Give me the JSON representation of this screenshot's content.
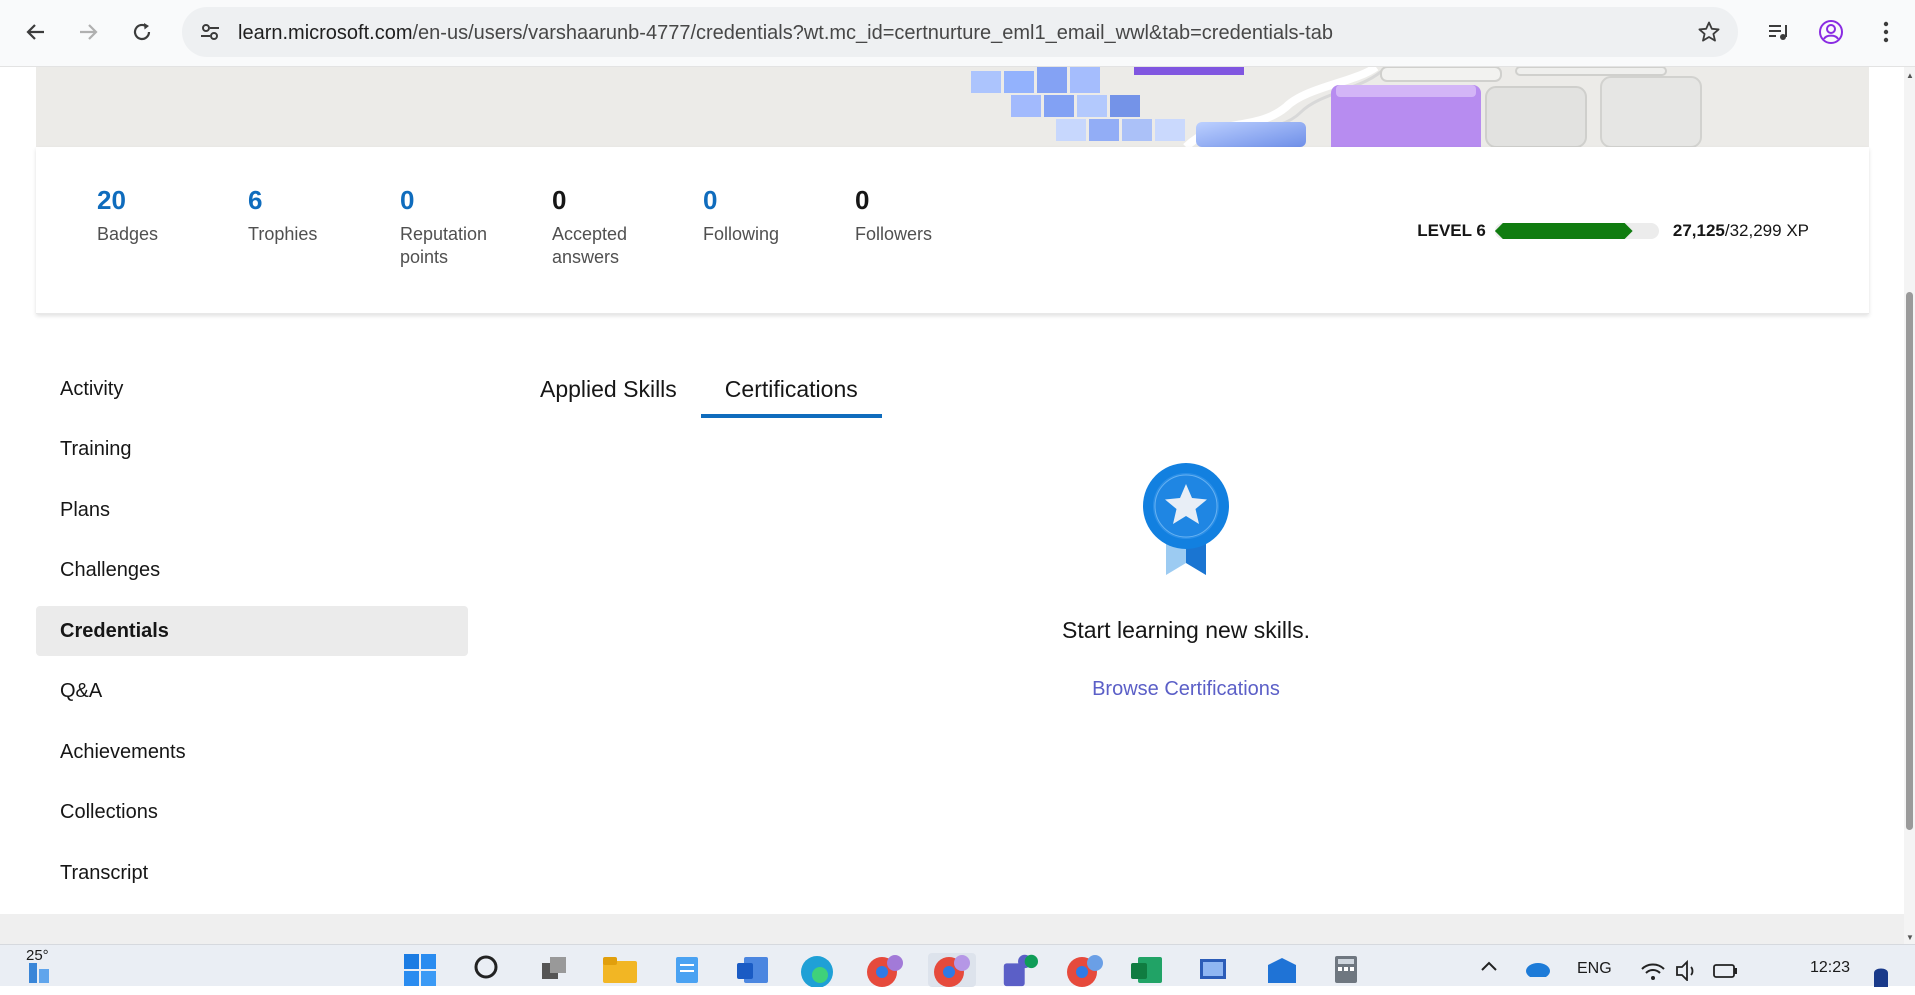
{
  "browser": {
    "url_host": "learn.microsoft.com",
    "url_path": "/en-us/users/varshaarunb-4777/credentials?wt.mc_id=certnurture_eml1_email_wwl&tab=credentials-tab"
  },
  "stats": [
    {
      "value": "20",
      "label": "Badges"
    },
    {
      "value": "6",
      "label": "Trophies"
    },
    {
      "value": "0",
      "label": "Reputation points"
    },
    {
      "value": "0",
      "label": "Accepted answers"
    },
    {
      "value": "0",
      "label": "Following"
    },
    {
      "value": "0",
      "label": "Followers"
    }
  ],
  "level": {
    "label": "LEVEL 6",
    "xp_current": "27,125",
    "xp_total": "/32,299 XP",
    "progress_fraction": 0.84
  },
  "sidebar": {
    "items": [
      {
        "label": "Activity"
      },
      {
        "label": "Training"
      },
      {
        "label": "Plans"
      },
      {
        "label": "Challenges"
      },
      {
        "label": "Credentials"
      },
      {
        "label": "Q&A"
      },
      {
        "label": "Achievements"
      },
      {
        "label": "Collections"
      },
      {
        "label": "Transcript"
      }
    ],
    "active_index": 4
  },
  "tabs": {
    "items": [
      {
        "label": "Applied Skills"
      },
      {
        "label": "Certifications"
      }
    ],
    "active_index": 1
  },
  "empty_state": {
    "message": "Start learning new skills.",
    "link_label": "Browse Certifications"
  },
  "taskbar": {
    "weather": "25°",
    "language": "ENG",
    "time": "12:23"
  },
  "colors": {
    "accent": "#0f6cbd",
    "progress": "#107c10",
    "link": "#5b5fc7"
  }
}
